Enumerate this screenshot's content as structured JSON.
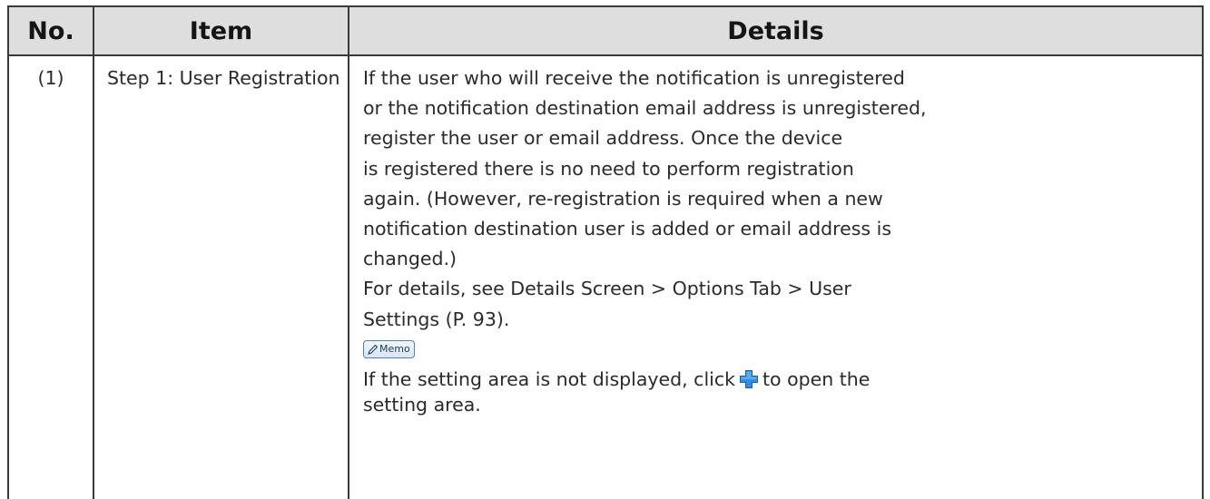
{
  "table": {
    "headers": {
      "no": "No.",
      "item": "Item",
      "details": "Details"
    },
    "row": {
      "no": "(1)",
      "item": "Step 1: User Registration",
      "details_lines": [
        "If the user who will receive the notification is unregistered",
        "or the notification destination email address is unregistered,",
        "register the user or email address. Once the device",
        "is registered there is no need to perform registration",
        "again. (However, re-registration is required when a new",
        "notification destination user is added or email address is",
        "changed.)",
        "For details, see Details Screen > Options Tab > User",
        "Settings (P. 93)."
      ],
      "memo_label": "Memo",
      "memo_text_before": "If the setting area is not displayed, click",
      "memo_text_after": "to open the",
      "memo_text_line2": "setting area."
    }
  },
  "icons": {
    "memo": "pencil-icon",
    "expand": "blue-plus-icon"
  },
  "colors": {
    "header_bg": "#dedede",
    "border": "#3a3a3a",
    "plus_icon": "#2f8fe0",
    "memo_border": "#4f7dbd"
  }
}
